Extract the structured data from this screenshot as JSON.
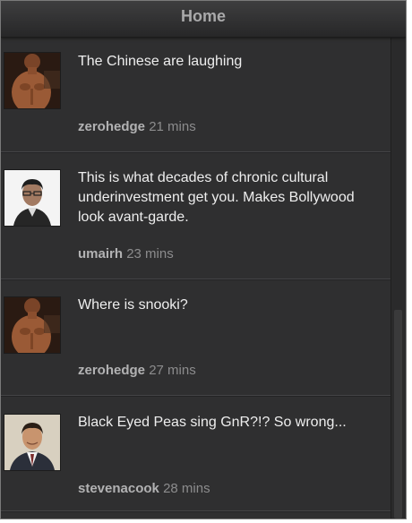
{
  "header": {
    "title": "Home"
  },
  "feed": {
    "items": [
      {
        "text": "The Chinese are laughing",
        "user": "zerohedge",
        "time": "21 mins",
        "avatar": "shirtless-man-avatar"
      },
      {
        "text": "This is what decades of chronic cultural underinvestment get you. Makes Bollywood look avant-garde.",
        "user": "umairh",
        "time": "23 mins",
        "avatar": "man-with-glasses-avatar"
      },
      {
        "text": "Where is snooki?",
        "user": "zerohedge",
        "time": "27 mins",
        "avatar": "shirtless-man-avatar"
      },
      {
        "text": "Black Eyed Peas sing GnR?!? So wrong...",
        "user": "stevenacook",
        "time": "28 mins",
        "avatar": "man-in-suit-avatar"
      }
    ]
  },
  "colors": {
    "background": "#2f2f30",
    "header": "#333334",
    "text": "#eeeeee",
    "username": "#b2b2b3",
    "timestamp": "#8c8c8d"
  }
}
